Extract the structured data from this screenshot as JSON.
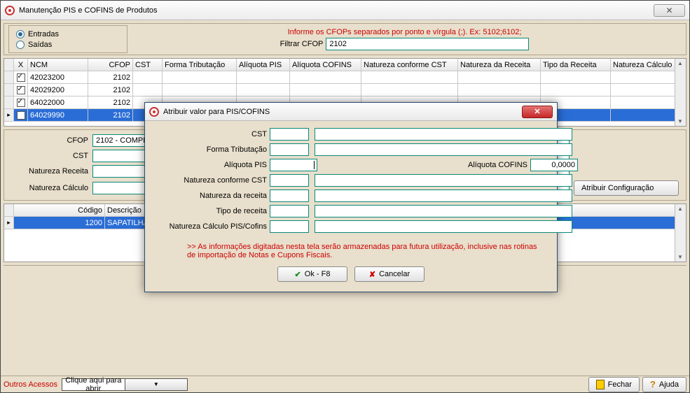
{
  "window": {
    "title": "Manutenção PIS e COFINS de Produtos"
  },
  "radios": {
    "entradas": "Entradas",
    "saidas": "Saídas"
  },
  "hint": "Informe os CFOPs separados por ponto e vírgula (;). Ex: 5102;6102;",
  "filter": {
    "label": "Filtrar CFOP",
    "value": "2102"
  },
  "grid_headers": {
    "x": "X",
    "ncm": "NCM",
    "cfop": "CFOP",
    "cst": "CST",
    "forma": "Forma Tributação",
    "apis": "Alíquota PIS",
    "acof": "Alíquota COFINS",
    "nat": "Natureza conforme CST",
    "natr": "Natureza da Receita",
    "tipor": "Tipo da Receita",
    "natc": "Natureza Cálculo"
  },
  "grid_rows": [
    {
      "ncm": "42023200",
      "cfop": "2102"
    },
    {
      "ncm": "42029200",
      "cfop": "2102"
    },
    {
      "ncm": "64022000",
      "cfop": "2102"
    },
    {
      "ncm": "64029990",
      "cfop": "2102"
    }
  ],
  "mid": {
    "cfop_label": "CFOP",
    "cfop_value": "2102 - COMPRA PA",
    "cst_label": "CST",
    "natr_label": "Natureza Receita",
    "natc_label": "Natureza Cálculo",
    "atribuir": "Atribuir Configuração"
  },
  "grid2_headers": {
    "cod": "Código",
    "desc": "Descrição"
  },
  "grid2_rows": [
    {
      "cod": "1200",
      "desc": "SAPATILHA ZAXY       16919 GRENDENE"
    }
  ],
  "footer_ok": "Ok",
  "bottom": {
    "outros": "Outros Acessos",
    "combo": "Clique aqui para abrir",
    "fechar": "Fechar",
    "ajuda": "Ajuda"
  },
  "modal": {
    "title": "Atribuir valor para PIS/COFINS",
    "cst": "CST",
    "forma": "Forma Tributação",
    "apis": "Alíquota PIS",
    "acof": "Alíquota COFINS",
    "acof_value": "0,0000",
    "nat": "Natureza conforme CST",
    "natr": "Natureza da receita",
    "tipor": "Tipo de receita",
    "natc": "Natureza Cálculo PIS/Cofins",
    "note": ">> As informações digitadas nesta tela serão armazenadas para futura utilização, inclusive nas rotinas de importação de Notas e Cupons Fiscais.",
    "ok": "Ok - F8",
    "cancel": "Cancelar"
  }
}
